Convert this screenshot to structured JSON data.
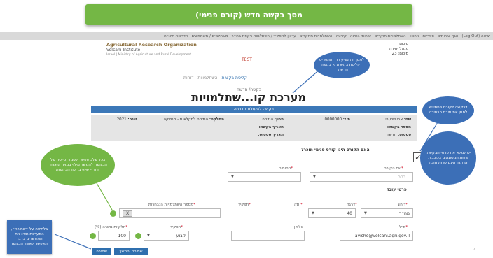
{
  "banner": {
    "title": "מסך בקשה חדש (קורס פנימי)"
  },
  "nav": {
    "items": [
      "יציאה (Log Out)",
      "אגף שירותים",
      "ספריות",
      "ארכיון",
      "השתלמויות חוקרים",
      "שירותי בחינה",
      "קליטה",
      "השתלמויות מחקרים",
      "עדכון לתפקיד / השתלמות ניקוזת בת״ר",
      "משתלמים / משתמשים",
      "הדרכות חיוניות"
    ]
  },
  "org": {
    "name": "Agricultural Research Organization",
    "institute": "Volcani Institute",
    "ministry": "Israel | Ministry of Agriculture and Rural Development"
  },
  "env_label": "TEST",
  "user_info": [
    "סיכום",
    "מנהל יחידה",
    "סיכום: 23"
  ],
  "subnav": {
    "items": [
      "קליטת בקשות",
      "השתלמויות",
      "דוחות"
    ]
  },
  "breadcrumb": "בקשה/ חדשה",
  "system_title": "מערכת קו...שתלמויות",
  "request_bar": "בקשה לפעולת הדרכה",
  "summary": {
    "name_label": "שם:",
    "name_value": "אבי שרעבי",
    "id_label": "ת.ז:",
    "id_value": "0000000",
    "unit_label": "מכון:",
    "unit_value": "הנדסה",
    "dept_label": "מחלקה:",
    "dept_value": "הנדסה לחקלאות - מחלקה",
    "year_label": "שנה:",
    "year_value": "2021",
    "request_no_label": "מספר בקשה:",
    "request_date_label": "תאריך בקשה:",
    "status_label": "סטטוס:",
    "status_value": "חדשה",
    "status_date_label": "תאריך סטטוס:"
  },
  "form": {
    "internal_question": "האם הקורס הינו קורס פנימי מוכר?",
    "course_name_label": "שם הקורס",
    "course_name_value": "בחר...",
    "topics_label": "תחומים",
    "worker_details_title": "פרטי עובד",
    "rank_label": "דירוג",
    "rank_value": "מח״ר",
    "grade_label": "דרגה",
    "grade_value": "40",
    "seniority_label": "ותק",
    "expertise_label": "תפקיד",
    "hours_label": "מספר השתלמויות הנבחרות",
    "hours_value": "X",
    "email_label": "מייל",
    "email_value": "avishe@volcani.agri.gov.il",
    "phone_label": "טלפון",
    "job_label": "תפקיד",
    "job_value": "קבוע",
    "percent_label": "חלקיות משרה (%)",
    "percent_value": "100",
    "save_button": "שמירה",
    "save_submit_button": "שמירה והמשך"
  },
  "callouts": {
    "nav_note": "למסך זה מגיע דרך התפריט ״קליטת בקשות > בקשה חדשה״",
    "internal_note": "לבקשה לקורס פנימי יש לסמן את תיבת הבחירה",
    "fill_note": "יש למלא את פרטי הבקשה, שדות המסומנים בכוכבית אדומה הינם שדות חובה",
    "stage_note": "בכל שלב אפשר לשמור טיוטה של הבקשה להמשך מילוי במועד מאוחר יותר - שיוע בריכוז הבקשות",
    "save_note": "בלחיצה על ״שמירה״, המערכת תציג את המאשרים בדבר ותאפשר לאשר הבקשה"
  },
  "page_number": "4",
  "colors": {
    "banner": "#74b745",
    "nav_blue": "#3c78b8",
    "callout_blue": "#3c6fb7",
    "graybox": "#e5e5e5"
  }
}
